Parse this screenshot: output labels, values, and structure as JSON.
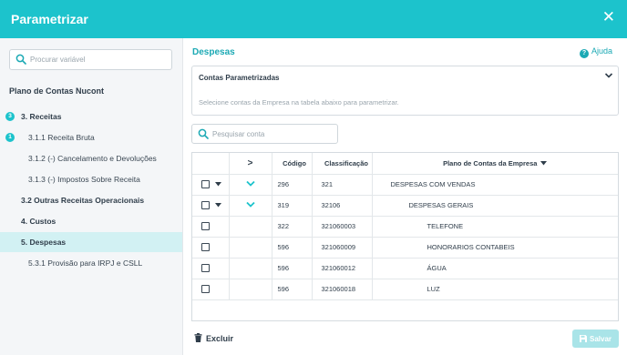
{
  "header": {
    "title": "Parametrizar",
    "close_symbol": "✕"
  },
  "sidebar": {
    "search_placeholder": "Procurar variável",
    "heading": "Plano de Contas Nucont",
    "items": [
      {
        "label": "3. Receitas",
        "badge": "3"
      },
      {
        "label": "3.1.1 Receita Bruta",
        "badge": "1"
      },
      {
        "label": "3.1.2 (-) Cancelamento e Devoluções"
      },
      {
        "label": "3.1.3 (-) Impostos Sobre Receita"
      },
      {
        "label": "3.2 Outras Receitas Operacionais"
      },
      {
        "label": "4. Custos"
      },
      {
        "label": "5. Despesas"
      },
      {
        "label": "5.3.1 Provisão para IRPJ e CSLL"
      }
    ]
  },
  "main": {
    "title": "Despesas",
    "help_label": "Ajuda",
    "panel": {
      "title": "Contas Parametrizadas",
      "hint": "Selecione contas da Empresa na tabela abaixo para parametrizar."
    },
    "search_placeholder": "Pesquisar conta",
    "table": {
      "headers": {
        "expand": ">",
        "codigo": "Código",
        "classificacao": "Classificação",
        "plano": "Plano de Contas da Empresa"
      },
      "rows": [
        {
          "codigo": "296",
          "classificacao": "321",
          "plano": "DESPESAS COM VENDAS"
        },
        {
          "codigo": "319",
          "classificacao": "32106",
          "plano": "DESPESAS GERAIS"
        },
        {
          "codigo": "322",
          "classificacao": "321060003",
          "plano": "TELEFONE"
        },
        {
          "codigo": "596",
          "classificacao": "321060009",
          "plano": "HONORARIOS CONTABEIS"
        },
        {
          "codigo": "596",
          "classificacao": "321060012",
          "plano": "ÁGUA"
        },
        {
          "codigo": "596",
          "classificacao": "321060018",
          "plano": "LUZ"
        }
      ]
    }
  },
  "footer": {
    "delete_label": "Excluir",
    "save_label": "Salvar"
  },
  "colors": {
    "accent": "#1cc3cc",
    "accent_text": "#1ba9b4",
    "active_bg": "#d2f1f3",
    "save_disabled": "#a9e4e8"
  }
}
